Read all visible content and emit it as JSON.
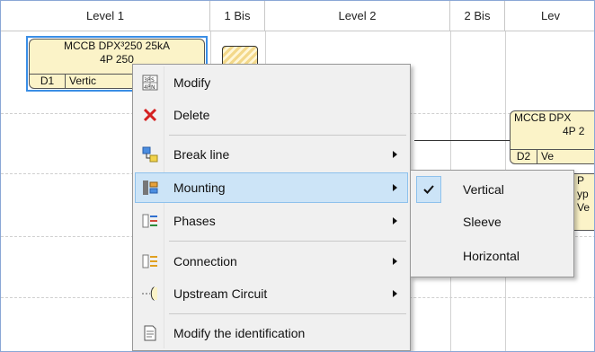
{
  "header": {
    "columns": [
      "Level 1",
      "1 Bis",
      "Level 2",
      "2 Bis",
      "Lev"
    ]
  },
  "breakers": {
    "main": {
      "line1": "MCCB DPX³250 25kA",
      "line2": "4P 250",
      "ref": "D1",
      "mount": "Vertic"
    },
    "second": {
      "line1": "MCCB DPX",
      "line2": "4P 2",
      "ref": "D2",
      "mount": "Ve"
    },
    "partial": {
      "line1": "P",
      "line2": "yp",
      "line3": "Ve"
    }
  },
  "context_menu": {
    "items": [
      {
        "label": "Modify",
        "icon": "modify-grid-icon",
        "has_submenu": false
      },
      {
        "label": "Delete",
        "icon": "delete-x-icon",
        "has_submenu": false
      },
      {
        "label": "Break line",
        "icon": "break-line-icon",
        "has_submenu": true
      },
      {
        "label": "Mounting",
        "icon": "mounting-icon",
        "has_submenu": true,
        "highlighted": true
      },
      {
        "label": "Phases",
        "icon": "phases-icon",
        "has_submenu": true
      },
      {
        "label": "Connection",
        "icon": "connection-icon",
        "has_submenu": true
      },
      {
        "label": "Upstream Circuit",
        "icon": "upstream-circuit-icon",
        "has_submenu": true
      },
      {
        "label": "Modify the identification",
        "icon": "identification-icon",
        "has_submenu": false
      }
    ]
  },
  "mounting_submenu": {
    "items": [
      {
        "label": "Vertical",
        "checked": true
      },
      {
        "label": "Sleeve",
        "checked": false
      },
      {
        "label": "Horizontal",
        "checked": false
      }
    ]
  },
  "colors": {
    "breaker_fill": "#fbf3c8",
    "selection": "#3a8ee6",
    "menu_highlight": "#cce4f7",
    "delete_red": "#d42020"
  }
}
